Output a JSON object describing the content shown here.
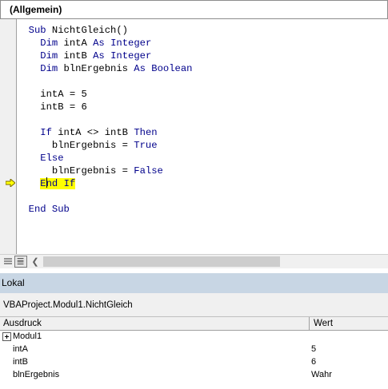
{
  "object_dropdown": {
    "value": "(Allgemein)"
  },
  "code": {
    "sub_kw": "Sub",
    "sub_name": " NichtGleich()",
    "dim_kw": "Dim",
    "as_kw": "As",
    "var_a": " intA ",
    "var_b": " intB ",
    "var_erg": " blnErgebnis ",
    "type_integer": " Integer",
    "type_boolean": " Boolean",
    "assign_a": "intA = 5",
    "assign_b": "intB = 6",
    "if_kw": "If",
    "if_cond": " intA <> intB ",
    "then_kw": "Then",
    "assign_true_pre": "blnErgebnis = ",
    "true_kw": "True",
    "else_kw": "Else",
    "assign_false_pre": "blnErgebnis = ",
    "false_kw": "False",
    "end_kw": "End",
    "endif_if_kw": "If",
    "endsub": "End Sub"
  },
  "locals": {
    "title": "Lokal",
    "context": "VBAProject.Modul1.NichtGleich",
    "columns": {
      "expression": "Ausdruck",
      "value": "Wert"
    },
    "rows": [
      {
        "expression": "Modul1",
        "value": ""
      },
      {
        "expression": "intA",
        "value": "5"
      },
      {
        "expression": "intB",
        "value": "6"
      },
      {
        "expression": "blnErgebnis",
        "value": "Wahr"
      }
    ]
  },
  "colors": {
    "keyword": "#00008b",
    "highlight": "#ffff00",
    "locals_title_bg": "#c8d6e4"
  },
  "icons": {
    "current_line": "execution-arrow-icon",
    "procedure_view": "procedure-view-icon",
    "full_module_view": "full-module-view-icon",
    "scroll_left": "chevron-left-icon",
    "expand": "expand-plus-icon"
  }
}
